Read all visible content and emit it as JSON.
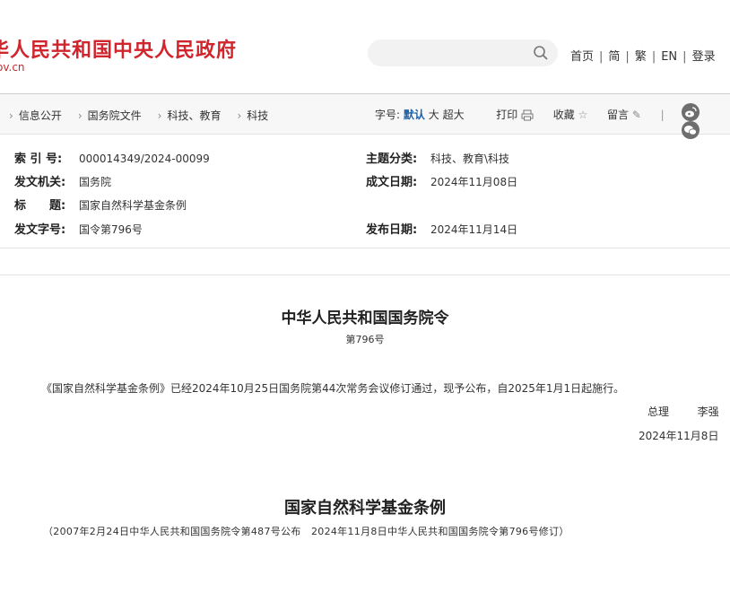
{
  "header": {
    "site_title": "华人民共和国中央人民政府",
    "site_url": "ov.cn",
    "search_placeholder": "",
    "links": [
      "首页",
      "简",
      "繁",
      "EN",
      "登录"
    ]
  },
  "breadcrumb": {
    "items": [
      "信息公开",
      "国务院文件",
      "科技、教育",
      "科技"
    ]
  },
  "tools": {
    "font_size_label": "字号:",
    "font_default": "默认",
    "font_large": "大",
    "font_xlarge": "超大",
    "print": "打印",
    "favorite": "收藏",
    "comment": "留言",
    "divider": "|"
  },
  "meta": {
    "index_label": "索 引 号:",
    "index_value": "000014349/2024-00099",
    "topic_label": "主题分类:",
    "topic_value": "科技、教育\\科技",
    "issuer_label": "发文机关:",
    "issuer_value": "国务院",
    "date_written_label": "成文日期:",
    "date_written_value": "2024年11月08日",
    "title_label": "标　　题:",
    "title_value": "国家自然科学基金条例",
    "doc_no_label": "发文字号:",
    "doc_no_value": "国令第796号",
    "publish_label": "发布日期:",
    "publish_value": "2024年11月14日"
  },
  "document": {
    "title": "中华人民共和国国务院令",
    "number": "第796号",
    "paragraph": "《国家自然科学基金条例》已经2024年10月25日国务院第44次常务会议修订通过，现予公布，自2025年1月1日起施行。",
    "signer_title": "总理",
    "signer_name": "李强",
    "sign_date": "2024年11月8日",
    "law_title": "国家自然科学基金条例",
    "law_subtitle": "（2007年2月24日中华人民共和国国务院令第487号公布　2024年11月8日中华人民共和国国务院令第796号修订）"
  },
  "colors": {
    "brand_red": "#d0252d",
    "active_blue": "#1f5fa6"
  }
}
